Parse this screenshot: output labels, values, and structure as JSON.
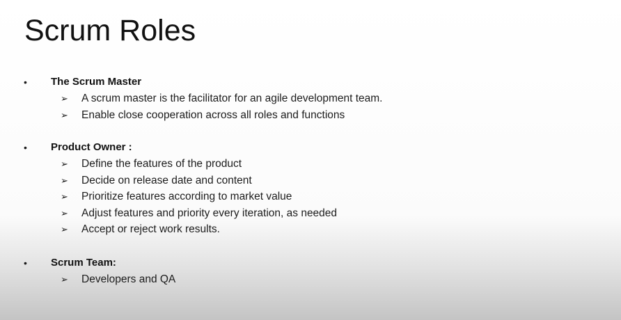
{
  "title": "Scrum Roles",
  "bullet_glyph": "•",
  "arrow_glyph": "➢",
  "sections": [
    {
      "heading": "The Scrum Master",
      "items": [
        "A scrum master is the facilitator for an agile development team.",
        "Enable close cooperation across all roles and functions"
      ]
    },
    {
      "heading": "Product Owner :",
      "items": [
        "Define the features of the product",
        "Decide on release date and content",
        "Prioritize features according to market value",
        "Adjust features and priority every iteration, as needed",
        "Accept or reject work results."
      ]
    },
    {
      "heading": "Scrum Team:",
      "items": [
        "Developers and QA"
      ]
    }
  ]
}
